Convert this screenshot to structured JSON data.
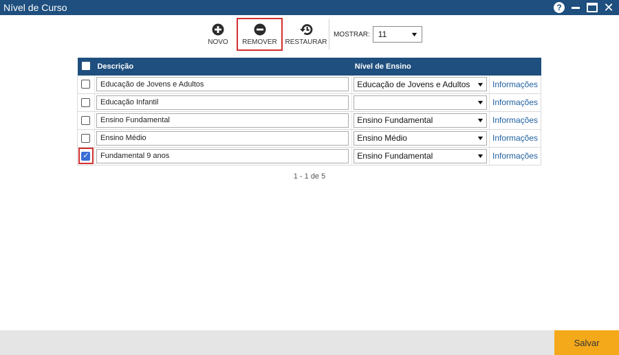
{
  "window": {
    "title": "Nível de Curso",
    "help_glyph": "?",
    "close_glyph": "✕"
  },
  "toolbar": {
    "novo_label": "NOVO",
    "remover_label": "REMOVER",
    "restaurar_label": "RESTAURAR",
    "mostrar_label": "MOSTRAR:",
    "mostrar_value": "11"
  },
  "grid": {
    "headers": {
      "descricao": "Descrição",
      "nivel": "Nível de Ensino"
    },
    "rows": [
      {
        "checked": false,
        "descricao": "Educação de Jovens e Adultos",
        "nivel": "Educação de Jovens e Adultos",
        "info": "Informações"
      },
      {
        "checked": false,
        "descricao": "Educação Infantil",
        "nivel": "",
        "info": "Informações"
      },
      {
        "checked": false,
        "descricao": "Ensino Fundamental",
        "nivel": "Ensino Fundamental",
        "info": "Informações"
      },
      {
        "checked": false,
        "descricao": "Ensino Médio",
        "nivel": "Ensino Médio",
        "info": "Informações"
      },
      {
        "checked": true,
        "descricao": "Fundamental 9 anos",
        "nivel": "Ensino Fundamental",
        "info": "Informações"
      }
    ]
  },
  "pager": {
    "text": "1 - 1 de 5"
  },
  "footer": {
    "save_label": "Salvar"
  },
  "colors": {
    "header_blue": "#1e4f7e",
    "highlight_red": "#d32f2f",
    "save_orange": "#f4a91b",
    "link_blue": "#1e5f9e"
  }
}
